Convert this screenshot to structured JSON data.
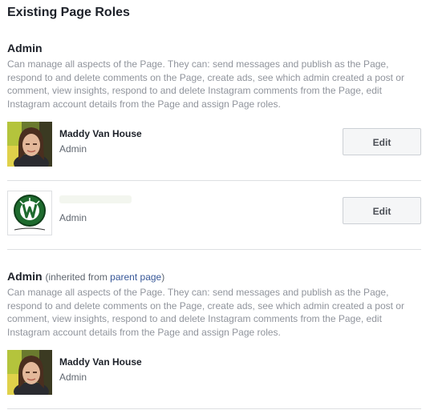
{
  "page": {
    "title": "Existing Page Roles"
  },
  "sections": [
    {
      "role_title": "Admin",
      "description": "Can manage all aspects of the Page. They can: send messages and publish as the Page, respond to and delete comments on the Page, create ads, see which admin created a post or comment, view insights, respond to and delete Instagram comments from the Page, edit Instagram account details from the Page and assign Page roles.",
      "members": [
        {
          "name": "Maddy Van House",
          "role": "Admin",
          "button_label": "Edit",
          "avatar": "profile-photo"
        },
        {
          "name": "",
          "role": "Admin",
          "button_label": "Edit",
          "avatar": "page-logo"
        }
      ]
    },
    {
      "role_title": "Admin",
      "inherited_prefix": "(inherited from ",
      "inherited_link": "parent page",
      "inherited_suffix": ")",
      "description": "Can manage all aspects of the Page. They can: send messages and publish as the Page, respond to and delete comments on the Page, create ads, see which admin created a post or comment, view insights, respond to and delete Instagram comments from the Page, edit Instagram account details from the Page and assign Page roles.",
      "members": [
        {
          "name": "Maddy Van House",
          "role": "Admin",
          "avatar": "profile-photo"
        }
      ]
    }
  ],
  "colors": {
    "link": "#385898",
    "secondary_text": "#90949c",
    "button_bg": "#f5f6f7",
    "divider": "#dddfe2"
  }
}
